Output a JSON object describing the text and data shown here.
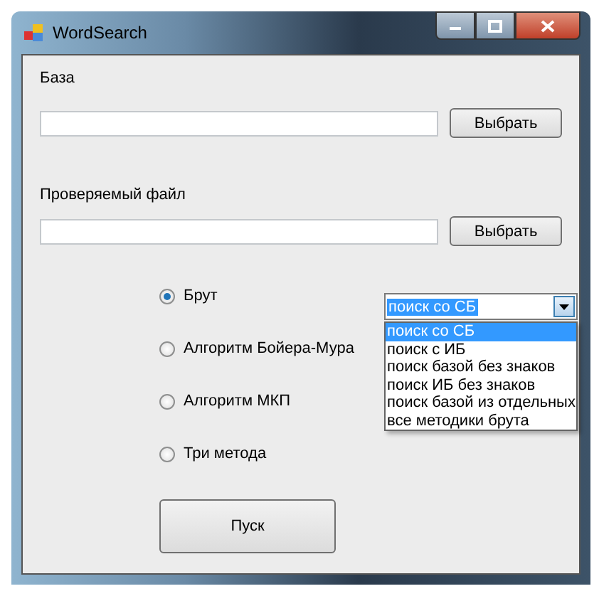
{
  "window": {
    "title": "WordSearch"
  },
  "base": {
    "label": "База",
    "button": "Выбрать"
  },
  "file": {
    "label": "Проверяемый файл",
    "button": "Выбрать"
  },
  "methods": [
    {
      "label": "Брут",
      "selected": true
    },
    {
      "label": "Алгоритм Бойера-Мура",
      "selected": false
    },
    {
      "label": "Алгоритм МКП",
      "selected": false
    },
    {
      "label": "Три метода",
      "selected": false
    }
  ],
  "combo": {
    "value": "поиск со СБ",
    "expanded": true,
    "options": [
      {
        "label": "поиск со СБ",
        "selected": true
      },
      {
        "label": "поиск с ИБ",
        "selected": false
      },
      {
        "label": "поиск базой без знаков",
        "selected": false
      },
      {
        "label": "поиск ИБ без знаков",
        "selected": false
      },
      {
        "label": "поиск базой из отдельных",
        "selected": false
      },
      {
        "label": "все методики брута",
        "selected": false
      }
    ]
  },
  "start_button": "Пуск"
}
